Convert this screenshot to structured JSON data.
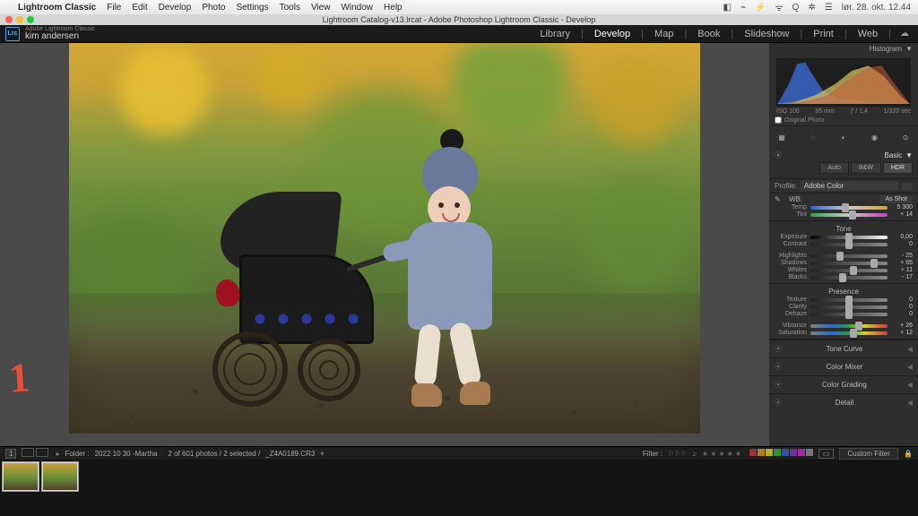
{
  "menubar": {
    "app": "Lightroom Classic",
    "items": [
      "File",
      "Edit",
      "Develop",
      "Photo",
      "Settings",
      "Tools",
      "View",
      "Window",
      "Help"
    ],
    "clock": "lør. 28. okt.  12.44",
    "status_icons": [
      "◧",
      "⌁",
      "⚡",
      "ᯤ",
      "Q",
      "✲",
      "☰"
    ]
  },
  "titlebar": "Lightroom Catalog-v13.lrcat - Adobe Photoshop Lightroom Classic - Develop",
  "identity": {
    "product": "Adobe Lightroom Classic",
    "user": "kim andersen",
    "logo": "Lrc"
  },
  "modules": [
    "Library",
    "Develop",
    "Map",
    "Book",
    "Slideshow",
    "Print",
    "Web"
  ],
  "modules_active": "Develop",
  "viewer_mark": "1",
  "histogram": {
    "title": "Histogram",
    "iso": "ISO 100",
    "focal": "85 mm",
    "aperture": "ƒ / 1,4",
    "shutter": "1/320 sec",
    "original": "Original Photo"
  },
  "basic": {
    "title": "Basic",
    "treat": {
      "auto": "Auto",
      "bw": "B&W",
      "hdr": "HDR"
    },
    "profile_lbl": "Profile:",
    "profile_val": "Adobe Color",
    "wb_lbl": "WB:",
    "wb_val": "As Shot",
    "tone": "Tone",
    "presence": "Presence",
    "sliders": {
      "temp": {
        "lbl": "Temp",
        "val": "5 300"
      },
      "tint": {
        "lbl": "Tint",
        "val": "+ 14"
      },
      "exposure": {
        "lbl": "Exposure",
        "val": "0,00"
      },
      "contrast": {
        "lbl": "Contrast",
        "val": "0"
      },
      "highlights": {
        "lbl": "Highlights",
        "val": "- 25"
      },
      "shadows": {
        "lbl": "Shadows",
        "val": "+ 65"
      },
      "whites": {
        "lbl": "Whites",
        "val": "+ 11"
      },
      "blacks": {
        "lbl": "Blacks",
        "val": "- 17"
      },
      "texture": {
        "lbl": "Texture",
        "val": "0"
      },
      "clarity": {
        "lbl": "Clarity",
        "val": "0"
      },
      "dehaze": {
        "lbl": "Dehaze",
        "val": "0"
      },
      "vibrance": {
        "lbl": "Vibrance",
        "val": "+ 26"
      },
      "saturation": {
        "lbl": "Saturation",
        "val": "+ 12"
      }
    }
  },
  "closed_panels": [
    "Tone Curve",
    "Color Mixer",
    "Color Grading",
    "Detail"
  ],
  "toolbar": {
    "badge": "1",
    "folder_lbl": "Folder :",
    "folder": "2022 10 30 -Martha",
    "count": "2 of 601 photos / 2 selected /",
    "file": "_Z4A0189.CR3",
    "filter": "Filter :",
    "custom": "Custom Filter",
    "swatches": [
      "#a03030",
      "#b08020",
      "#b0b020",
      "#309030",
      "#3050a0",
      "#7030a0",
      "#a030a0",
      "#777"
    ]
  },
  "chart_data": {
    "type": "area",
    "title": "Histogram",
    "xlabel": "",
    "ylabel": "",
    "xlim": [
      0,
      255
    ],
    "ylim": [
      0,
      100
    ],
    "series": [
      {
        "name": "Blue",
        "color": "#3a66c8",
        "x": [
          0,
          20,
          40,
          55,
          70,
          90,
          110,
          140,
          255
        ],
        "y": [
          2,
          12,
          55,
          90,
          60,
          30,
          12,
          4,
          0
        ]
      },
      {
        "name": "Green",
        "color": "#6a9a3a",
        "x": [
          0,
          40,
          80,
          110,
          140,
          170,
          200,
          230,
          255
        ],
        "y": [
          0,
          6,
          20,
          45,
          70,
          85,
          60,
          18,
          2
        ]
      },
      {
        "name": "Red",
        "color": "#c85a3a",
        "x": [
          0,
          50,
          100,
          140,
          170,
          200,
          230,
          255
        ],
        "y": [
          0,
          4,
          14,
          40,
          72,
          88,
          40,
          4
        ]
      }
    ]
  }
}
